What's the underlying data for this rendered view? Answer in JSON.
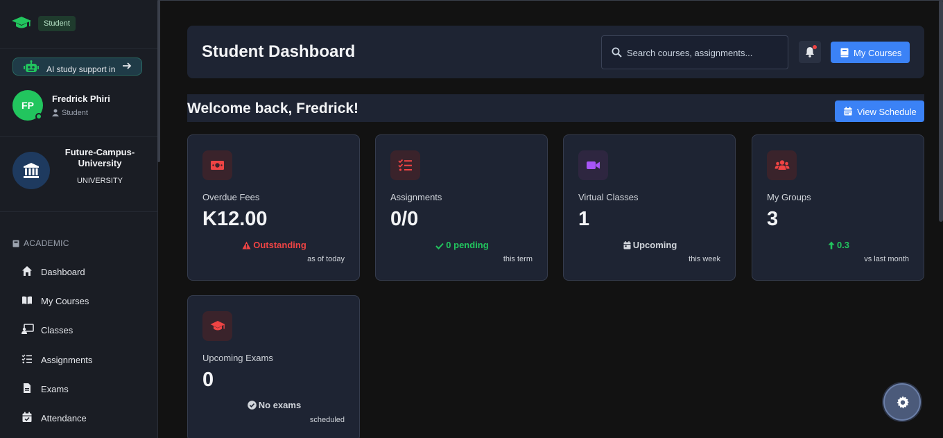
{
  "sidebar": {
    "role_badge": "Student",
    "ai_banner": {
      "text": "AI study support in",
      "icons": [
        "robot-icon",
        "arrow-right-icon"
      ]
    },
    "user": {
      "initials": "FP",
      "name": "Fredrick Phiri",
      "role": "Student",
      "status_color": "#22c55e"
    },
    "university": {
      "name": "Future-Campus-University",
      "type": "UNIVERSITY"
    },
    "section": "ACADEMIC",
    "nav": [
      {
        "label": "Dashboard",
        "icon": "home-icon"
      },
      {
        "label": "My Courses",
        "icon": "book-open-icon"
      },
      {
        "label": "Classes",
        "icon": "chalkboard-icon"
      },
      {
        "label": "Assignments",
        "icon": "tasks-icon"
      },
      {
        "label": "Exams",
        "icon": "file-icon"
      },
      {
        "label": "Attendance",
        "icon": "calendar-check-icon"
      }
    ]
  },
  "header": {
    "title": "Student Dashboard",
    "search_placeholder": "Search courses, assignments...",
    "my_courses_label": "My Courses"
  },
  "welcome": {
    "text": "Welcome back, Fredrick!",
    "view_schedule_label": "View Schedule"
  },
  "cards": [
    {
      "title": "Overdue Fees",
      "value": "K12.00",
      "status": "Outstanding",
      "status_color": "#ef4444",
      "note": "as of today",
      "icon": "money-bill-icon",
      "icon_color": "#ef4444"
    },
    {
      "title": "Assignments",
      "value": "0/0",
      "status": "0 pending",
      "status_color": "#22c55e",
      "note": "this term",
      "icon": "tasks-icon",
      "icon_color": "#ef4444"
    },
    {
      "title": "Virtual Classes",
      "value": "1",
      "status": "Upcoming",
      "status_color": "#d1d5db",
      "note": "this week",
      "icon": "video-icon",
      "icon_color": "#a855f7"
    },
    {
      "title": "My Groups",
      "value": "3",
      "status": "0.3",
      "status_color": "#22c55e",
      "note": "vs last month",
      "icon": "users-icon",
      "icon_color": "#ef4444"
    },
    {
      "title": "Upcoming Exams",
      "value": "0",
      "status": "No exams",
      "status_color": "#d1d5db",
      "note": "scheduled",
      "icon": "graduation-cap-icon",
      "icon_color": "#ef4444"
    }
  ],
  "colors": {
    "accent": "#3b82f6",
    "brand_green": "#22c55e",
    "card_bg": "#1e2433",
    "page_bg": "#121212"
  }
}
